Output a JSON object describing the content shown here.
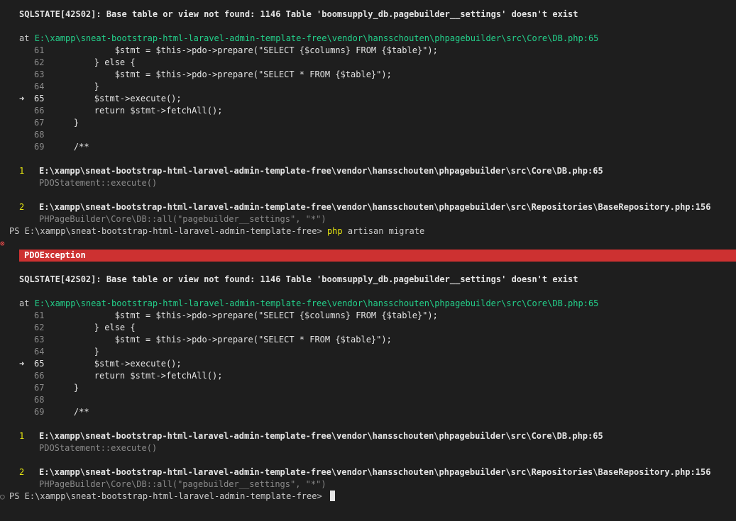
{
  "error": {
    "message": "SQLSTATE[42S02]: Base table or view not found: 1146 Table 'boomsupply_db.pagebuilder__settings' doesn't exist",
    "at_prefix": "at",
    "location": "E:\\xampp\\sneat-bootstrap-html-laravel-admin-template-free\\vendor\\hansschouten\\phpagebuilder\\src\\Core\\DB.php:65",
    "arrow": "➜",
    "code_lines": [
      {
        "num": "61",
        "code": "            $stmt = $this->pdo->prepare(\"SELECT {$columns} FROM {$table}\");",
        "current": false
      },
      {
        "num": "62",
        "code": "        } else {",
        "current": false
      },
      {
        "num": "63",
        "code": "            $stmt = $this->pdo->prepare(\"SELECT * FROM {$table}\");",
        "current": false
      },
      {
        "num": "64",
        "code": "        }",
        "current": false
      },
      {
        "num": "65",
        "code": "        $stmt->execute();",
        "current": true
      },
      {
        "num": "66",
        "code": "        return $stmt->fetchAll();",
        "current": false
      },
      {
        "num": "67",
        "code": "    }",
        "current": false
      },
      {
        "num": "68",
        "code": "",
        "current": false
      },
      {
        "num": "69",
        "code": "    /**",
        "current": false
      }
    ],
    "frames": [
      {
        "index": "1",
        "path": "E:\\xampp\\sneat-bootstrap-html-laravel-admin-template-free\\vendor\\hansschouten\\phpagebuilder\\src\\Core\\DB.php:65",
        "call": "PDOStatement::execute()"
      },
      {
        "index": "2",
        "path": "E:\\xampp\\sneat-bootstrap-html-laravel-admin-template-free\\vendor\\hansschouten\\phpagebuilder\\src\\Repositories\\BaseRepository.php:156",
        "call": "PHPageBuilder\\Core\\DB::all(\"pagebuilder__settings\", \"*\")"
      }
    ],
    "exception_name": "PDOException"
  },
  "prompt": {
    "text": "PS E:\\xampp\\sneat-bootstrap-html-laravel-admin-template-free> ",
    "command_keyword": "php",
    "command_args": " artisan migrate"
  },
  "marks": {
    "error": "⊗",
    "ok": "○"
  },
  "colors": {
    "background": "#1e1e1e",
    "banner": "#cd3131",
    "path_green": "#23d18b",
    "frame_index_yellow": "#e5e510"
  }
}
